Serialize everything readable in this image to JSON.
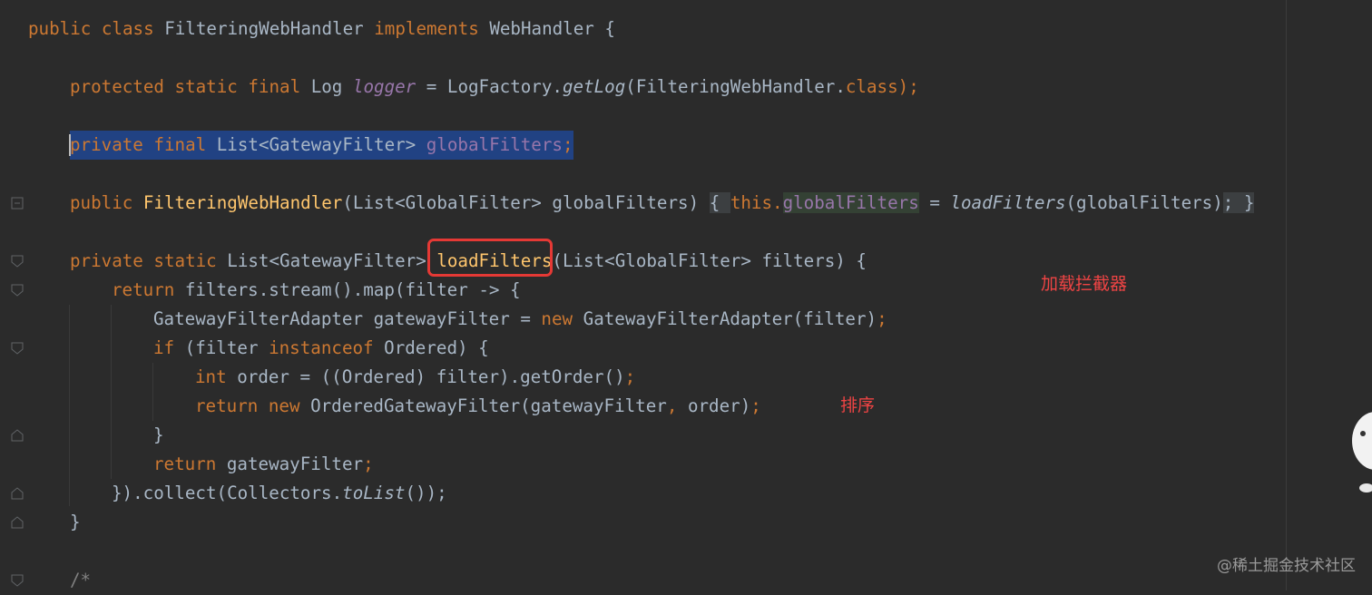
{
  "editor": {
    "lines": {
      "l1": {
        "kw1": "public class ",
        "name": "FilteringWebHandler ",
        "kw2": "implements ",
        "rest": "WebHandler {"
      },
      "l2": {
        "kw": "protected static final ",
        "type": "Log ",
        "field": "logger",
        "eq": " = LogFactory.",
        "method": "getLog",
        "args": "(FilteringWebHandler.",
        "cls": "class",
        "end": ");"
      },
      "l3": {
        "kw": "private final ",
        "type": "List<GatewayFilter> ",
        "field": "globalFilters",
        "end": ";"
      },
      "l4": {
        "kw": "public ",
        "name": "FilteringWebHandler",
        "params": "(List<GlobalFilter> globalFilters) ",
        "ob": "{ ",
        "this": "this.",
        "field": "globalFilters",
        "eq": " = ",
        "method": "loadFilters",
        "args": "(globalFilters)",
        "semi": "; ",
        "cb": "}"
      },
      "l5": {
        "kw": "private static ",
        "type": "List<GatewayFilter> ",
        "name": "loadFilters",
        "params": "(List<GlobalFilter> filters) {"
      },
      "l6": {
        "kw": "return ",
        "rest": "filters.stream().map(filter -> {"
      },
      "l7": {
        "pre": "GatewayFilterAdapter gatewayFilter = ",
        "kw": "new ",
        "rest": "GatewayFilterAdapter(filter)",
        "end": ";"
      },
      "l8": {
        "kw": "if ",
        "p1": "(filter ",
        "kw2": "instanceof ",
        "p2": "Ordered) {"
      },
      "l9": {
        "kw": "int ",
        "rest": "order = ((Ordered) filter).getOrder()",
        "end": ";"
      },
      "l10": {
        "kw": "return new ",
        "rest": "OrderedGatewayFilter(gatewayFilter",
        "comma": ", ",
        "rest2": "order)",
        "end": ";"
      },
      "l11": {
        "rest": "}"
      },
      "l12": {
        "kw": "return ",
        "rest": "gatewayFilter",
        "end": ";"
      },
      "l13": {
        "pre": "}).collect(Collectors.",
        "method": "toList",
        "end": "());"
      },
      "l14": {
        "rest": "}"
      },
      "l15": {
        "rest": "/*"
      }
    }
  },
  "annotations": {
    "load_filters": "加载拦截器",
    "sorting": "排序"
  },
  "watermark": "@稀土掘金技术社区",
  "colors": {
    "background": "#2b2b2b",
    "keyword": "#cc7832",
    "function": "#ffc66d",
    "field": "#9876aa",
    "text": "#a9b7c6",
    "selection": "#214283",
    "annotation": "#ef4444"
  }
}
